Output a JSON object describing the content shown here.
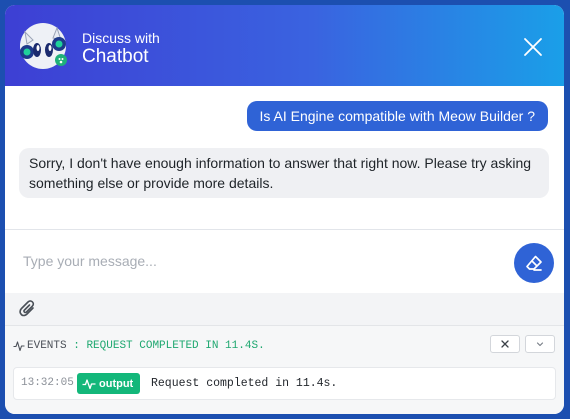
{
  "header": {
    "subtitle": "Discuss with",
    "title": "Chatbot",
    "gradient_start": "#3d3fd4",
    "gradient_end": "#1a9fe8"
  },
  "messages": [
    {
      "role": "user",
      "text": "Is AI Engine compatible with Meow Builder ?"
    },
    {
      "role": "bot",
      "text": "Sorry, I don't have enough information to answer that right now. Please try asking something else or provide more details."
    }
  ],
  "input": {
    "placeholder": "Type your message...",
    "value": ""
  },
  "icons": {
    "close": "close-icon",
    "clear": "eraser-icon",
    "attach": "paperclip-icon",
    "events": "pulse-icon",
    "collapse": "chevron-down-icon"
  },
  "events": {
    "label": "EVENTS",
    "separator": ":",
    "status": "REQUEST COMPLETED IN 11.4S.",
    "items": [
      {
        "time": "13:32:05",
        "tag": "output",
        "message": "Request completed in 11.4s."
      }
    ]
  },
  "colors": {
    "accent": "#2f63d6",
    "success": "#13b77a",
    "bubble_bot": "#eff0f3"
  }
}
